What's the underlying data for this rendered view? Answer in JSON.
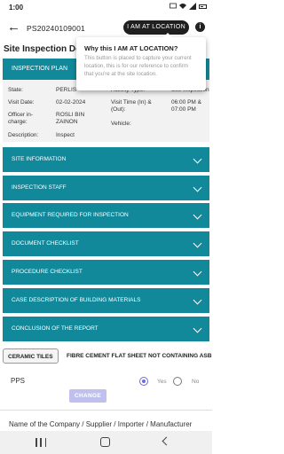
{
  "status_bar": {
    "time": "1:00"
  },
  "app_bar": {
    "reference": "PS20240109001",
    "location_button": "I AM AT LOCATION",
    "info_icon": "i"
  },
  "page_title": "Site Inspection Deta",
  "inspection_plan": {
    "header": "INSPECTION PLAN",
    "state_label": "State:",
    "state_value": "PERLIS",
    "activity_type_label": "Activity Type:",
    "activity_type_value": "Site Inspection",
    "visit_date_label": "Visit Date:",
    "visit_date_value": "02-02-2024",
    "visit_time_label": "Visit Time (In) & (Out):",
    "visit_time_value": "06:00 PM & 07:00 PM",
    "officer_label": "Officer in-charge:",
    "officer_value": "ROSLI BIN ZAINON",
    "vehicle_label": "Vehicle:",
    "description_label": "Description:",
    "description_value": "Inspect"
  },
  "sections": [
    {
      "label": "SITE INFORMATION"
    },
    {
      "label": "INSPECTION STAFF"
    },
    {
      "label": "EQUIPMENT REQUIRED FOR INSPECTION"
    },
    {
      "label": "DOCUMENT CHECKLIST"
    },
    {
      "label": "PROCEDURE CHECKLIST"
    },
    {
      "label": "CASE DESCRIPTION OF BUILDING MATERIALS"
    },
    {
      "label": "CONCLUSION OF THE REPORT"
    }
  ],
  "material_tabs": [
    {
      "label": "CERAMIC TILES",
      "active": true
    },
    {
      "label": "FIBRE CEMENT FLAT SHEET NOT CONTAINING ASBE",
      "active": false
    }
  ],
  "pps": {
    "label": "PPS",
    "yes_label": "Yes",
    "no_label": "No",
    "selected": "Yes",
    "change_button": "CHANGE"
  },
  "company_label": "Name of the Company / Supplier / Importer / Manufacturer",
  "tooltip": {
    "title": "Why this I AM AT LOCATION?",
    "body": "This button is placed to capture your current location, this is for our reference to confirm that you're at the site location."
  },
  "colors": {
    "teal": "#11899a",
    "radio_accent": "#6c6cd6",
    "change_button": "#c0c0ee",
    "location_button": "#1f1f1f"
  }
}
